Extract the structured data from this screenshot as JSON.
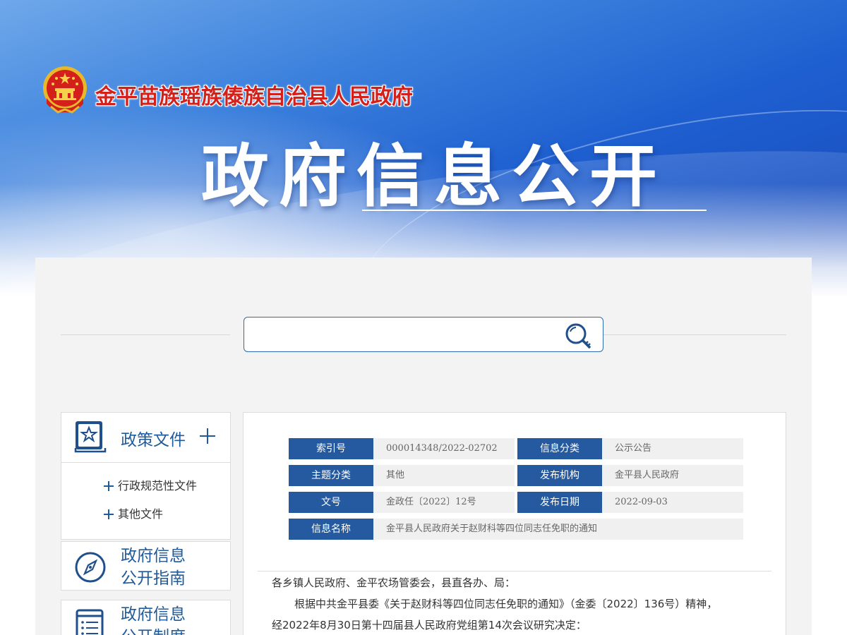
{
  "header": {
    "gov_name": "金平苗族瑶族傣族自治县人民政府",
    "page_title": "政府信息公开"
  },
  "search": {
    "value": "",
    "placeholder": ""
  },
  "sidebar": {
    "policy": {
      "title": "政策文件",
      "items": [
        {
          "label": "行政规范性文件"
        },
        {
          "label": "其他文件"
        }
      ]
    },
    "guide": {
      "title_line1": "政府信息",
      "title_line2": "公开指南"
    },
    "system": {
      "title_line1": "政府信息",
      "title_line2": "公开制度"
    }
  },
  "meta": {
    "index_label": "索引号",
    "index_value": "000014348/2022-02702",
    "category_label": "信息分类",
    "category_value": "公示公告",
    "topic_label": "主题分类",
    "topic_value": "其他",
    "org_label": "发布机构",
    "org_value": "金平县人民政府",
    "docno_label": "文号",
    "docno_value": "金政任〔2022〕12号",
    "date_label": "发布日期",
    "date_value": "2022-09-03",
    "name_label": "信息名称",
    "name_value": "金平县人民政府关于赵财科等四位同志任免职的通知"
  },
  "article": {
    "salutation": "各乡镇人民政府、金平农场管委会，县直各办、局：",
    "para1_line1": "根据中共金平县委《关于赵财科等四位同志任免职的通知》（金委〔2022〕136号）精神，",
    "para1_line2": "经2022年8月30日第十四届县人民政府党组第14次会议研究决定："
  },
  "colors": {
    "brand_blue": "#255aa0",
    "title_red": "#d4201b"
  }
}
